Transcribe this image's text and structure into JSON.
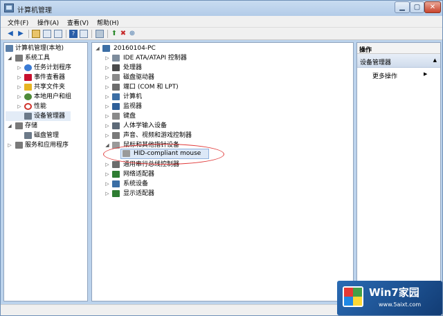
{
  "window": {
    "title": "计算机管理"
  },
  "menu": [
    {
      "label": "文件(F)"
    },
    {
      "label": "操作(A)"
    },
    {
      "label": "查看(V)"
    },
    {
      "label": "帮助(H)"
    }
  ],
  "left_tree": [
    {
      "label": "计算机管理(本地)",
      "icon": "computer-management-icon",
      "color": "#5b7fa8"
    },
    {
      "label": "系统工具",
      "icon": "tools-icon",
      "color": "#7a7a7a"
    },
    {
      "label": "任务计划程序",
      "icon": "clock-icon",
      "color": "#3a7bd5"
    },
    {
      "label": "事件查看器",
      "icon": "event-viewer-icon",
      "color": "#c8102e"
    },
    {
      "label": "共享文件夹",
      "icon": "shared-folder-icon",
      "color": "#e6b422"
    },
    {
      "label": "本地用户和组",
      "icon": "users-icon",
      "color": "#4f8b3a"
    },
    {
      "label": "性能",
      "icon": "performance-icon",
      "color": "#d0342c"
    },
    {
      "label": "设备管理器",
      "icon": "device-manager-icon",
      "color": "#6c7a89"
    },
    {
      "label": "存储",
      "icon": "storage-icon",
      "color": "#7a7a7a"
    },
    {
      "label": "磁盘管理",
      "icon": "disk-icon",
      "color": "#6c7a89"
    },
    {
      "label": "服务和应用程序",
      "icon": "services-icon",
      "color": "#7a7a7a"
    }
  ],
  "device_tree": {
    "root": "20160104-PC",
    "categories": [
      {
        "label": "IDE ATA/ATAPI 控制器",
        "icon": "ide-controller-icon",
        "color": "#7d8c9c"
      },
      {
        "label": "处理器",
        "icon": "processor-icon",
        "color": "#4a4a4a"
      },
      {
        "label": "磁盘驱动器",
        "icon": "disk-drive-icon",
        "color": "#8a8a8a"
      },
      {
        "label": "端口 (COM 和 LPT)",
        "icon": "port-icon",
        "color": "#6c6c6c"
      },
      {
        "label": "计算机",
        "icon": "computer-icon",
        "color": "#3b6ea5"
      },
      {
        "label": "监视器",
        "icon": "monitor-icon",
        "color": "#2e5f99"
      },
      {
        "label": "键盘",
        "icon": "keyboard-icon",
        "color": "#8a8a8a"
      },
      {
        "label": "人体学输入设备",
        "icon": "hid-icon",
        "color": "#5d6a78"
      },
      {
        "label": "声音、视频和游戏控制器",
        "icon": "sound-icon",
        "color": "#7a7a7a"
      },
      {
        "label": "鼠标和其他指针设备",
        "icon": "mouse-icon",
        "color": "#9a9a9a"
      },
      {
        "label": "HID-compliant mouse",
        "icon": "mouse-icon",
        "color": "#9a9a9a"
      },
      {
        "label": "通用串行总线控制器",
        "icon": "usb-icon",
        "color": "#6c6c6c"
      },
      {
        "label": "网络适配器",
        "icon": "network-adapter-icon",
        "color": "#2e7d32"
      },
      {
        "label": "系统设备",
        "icon": "system-device-icon",
        "color": "#3b6ea5"
      },
      {
        "label": "显示适配器",
        "icon": "display-adapter-icon",
        "color": "#2e7d32"
      }
    ]
  },
  "actions": {
    "header": "操作",
    "section": "设备管理器",
    "more": "更多操作"
  },
  "watermark": {
    "brand": "Win7家园",
    "url": "www.5aixt.com"
  }
}
